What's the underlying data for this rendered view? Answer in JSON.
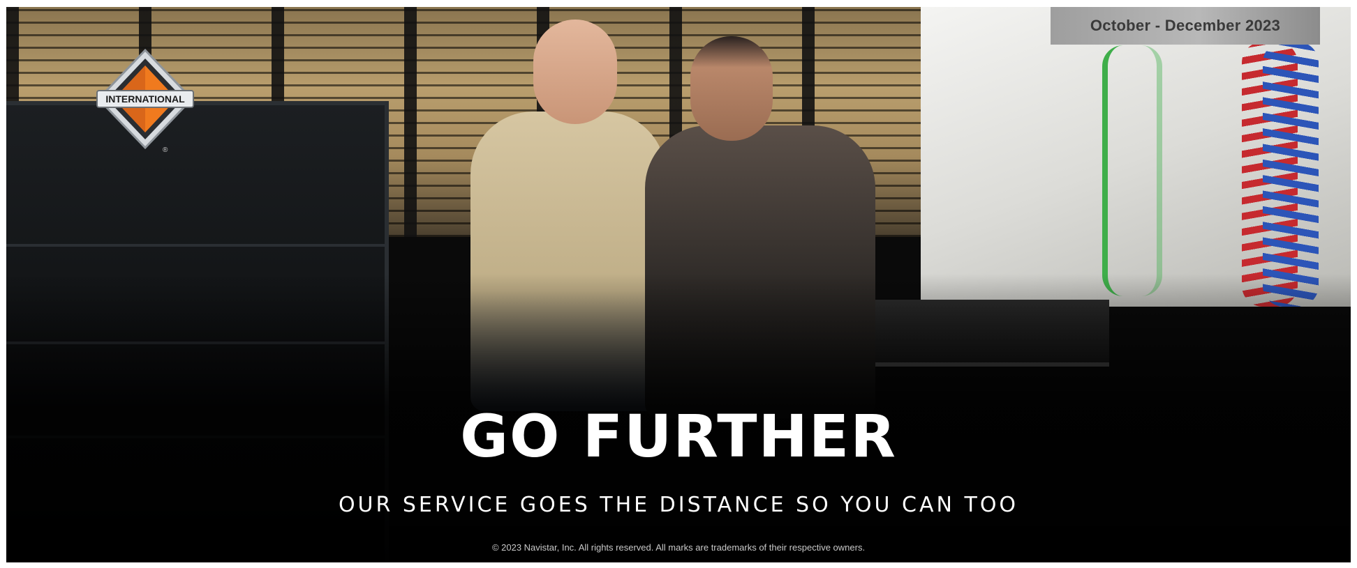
{
  "banner": {
    "date_range": "October - December 2023",
    "headline": "GO FURTHER",
    "subheadline": "OUR SERVICE GOES THE DISTANCE SO YOU CAN TOO",
    "copyright": "© 2023 Navistar, Inc. All rights reserved. All marks are trademarks of their respective owners."
  },
  "logo": {
    "brand_text": "INTERNATIONAL",
    "registered_mark": "®",
    "icon": "international-diamond-logo"
  },
  "colors": {
    "logo_orange": "#f07a1e",
    "logo_silver": "#c8ccd0",
    "date_badge_bg": "#a8a8a8",
    "date_badge_text": "#3a3a3a",
    "headline_text": "#ffffff"
  }
}
